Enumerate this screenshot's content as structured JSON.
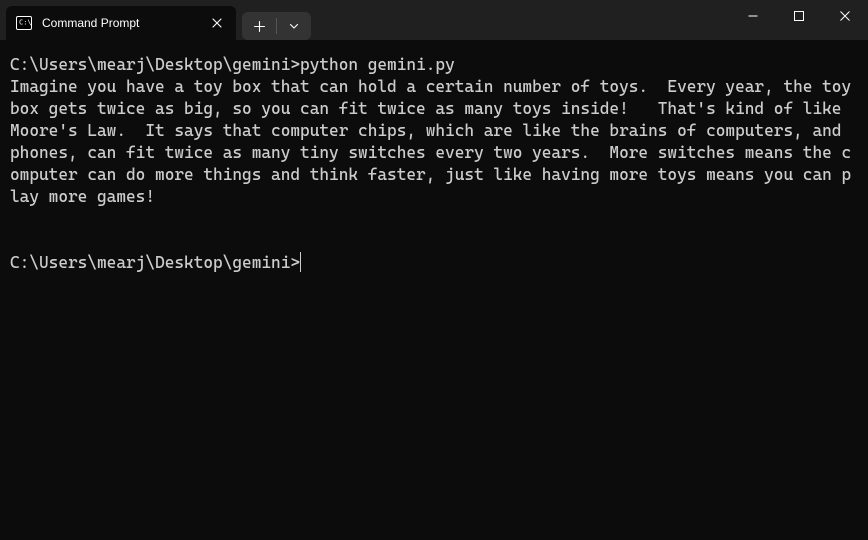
{
  "titlebar": {
    "tab": {
      "title": "Command Prompt",
      "icon_name": "cmd-icon"
    }
  },
  "terminal": {
    "prompt1_path": "C:\\Users\\mearj\\Desktop\\gemini>",
    "command1": "python gemini.py",
    "output": "Imagine you have a toy box that can hold a certain number of toys.  Every year, the toy box gets twice as big, so you can fit twice as many toys inside!   That's kind of like Moore's Law.  It says that computer chips, which are like the brains of computers, and phones, can fit twice as many tiny switches every two years.  More switches means the computer can do more things and think faster, just like having more toys means you can play more games!",
    "prompt2_path": "C:\\Users\\mearj\\Desktop\\gemini>"
  }
}
